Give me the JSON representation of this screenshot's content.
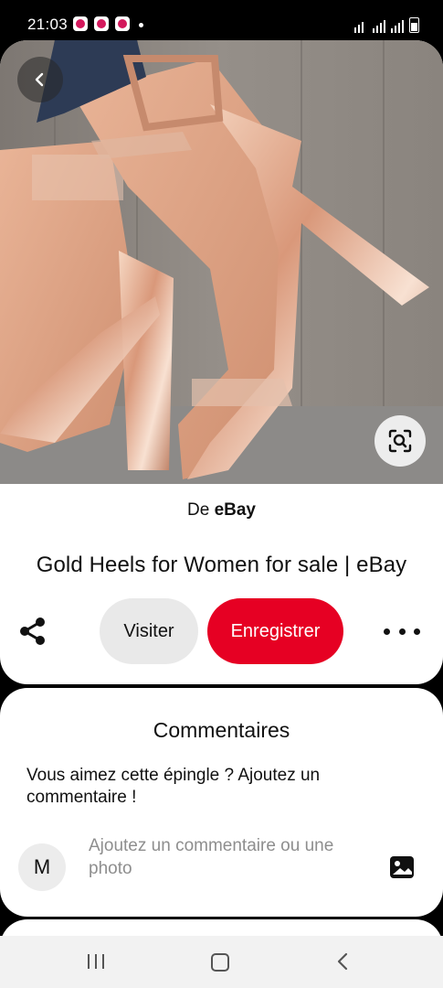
{
  "status_bar": {
    "time": "21:03",
    "notification_icons": [
      "pinterest-notification",
      "pinterest-notification",
      "pinterest-notification"
    ]
  },
  "pin": {
    "image_alt": "Gold Heels for Women",
    "source_prefix": "De",
    "source_name": "eBay",
    "title": "Gold Heels for Women for sale | eBay",
    "visit_label": "Visiter",
    "save_label": "Enregistrer",
    "accent_color": "#e60023"
  },
  "comments": {
    "title": "Commentaires",
    "prompt": "Vous aimez cette épingle ? Ajoutez un commentaire !",
    "avatar_initial": "M",
    "input_placeholder": "Ajoutez un commentaire ou une photo"
  },
  "icons": {
    "back": "chevron-left-icon",
    "visual_search": "lens-search-icon",
    "share": "share-icon",
    "more": "more-horizontal-icon",
    "photo": "image-icon"
  }
}
